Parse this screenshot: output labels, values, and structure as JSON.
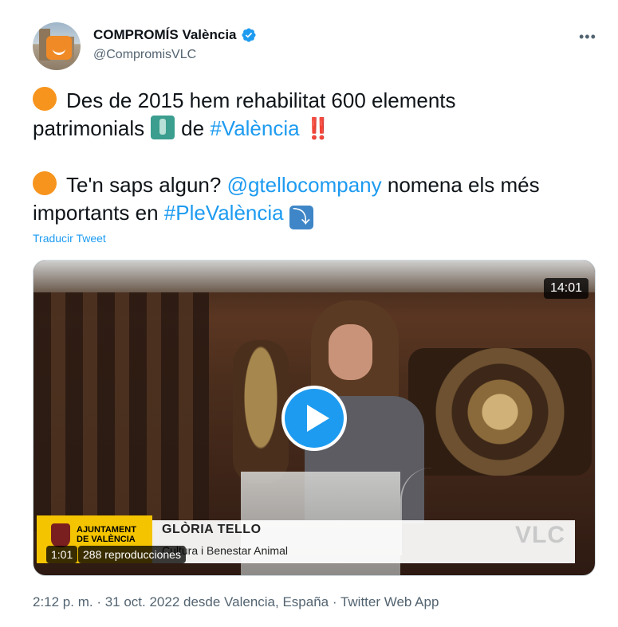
{
  "author": {
    "name": "COMPROMÍS València",
    "handle": "@CompromisVLC",
    "verified_icon": "verified-badge-icon",
    "more_label": "•••"
  },
  "tweet": {
    "line1": "Des de 2015 hem rehabilitat 600 elements",
    "line2_pre": "patrimonials",
    "line2_mid": "de",
    "line2_hashtag": "#València",
    "line2_bang": "‼️",
    "line3_pre": "Te'n saps algun?",
    "line3_mention": "@gtellocompany",
    "line3_post": "nomena els més",
    "line4_pre": "importants en",
    "line4_hashtag": "#PleValència",
    "line4_arrow": "⤵"
  },
  "translate_label": "Traducir Tweet",
  "video": {
    "duration": "14:01",
    "elapsed": "1:01",
    "views": "288 reproducciones",
    "lower_third": {
      "org_line1": "AJUNTAMENT",
      "org_line2": "DE VALÈNCIA",
      "name": "GLÒRIA TELLO",
      "role": "Cultura i Benestar Animal",
      "watermark": "VLC"
    }
  },
  "meta": {
    "time": "2:12 p. m.",
    "sep1": " · ",
    "date": "31 oct. 2022 desde Valencia, España",
    "sep2": " · ",
    "client": "Twitter Web App"
  },
  "colors": {
    "link": "#1d9bf0",
    "secondary_text": "#536471",
    "orange_dot": "#f7941d"
  }
}
